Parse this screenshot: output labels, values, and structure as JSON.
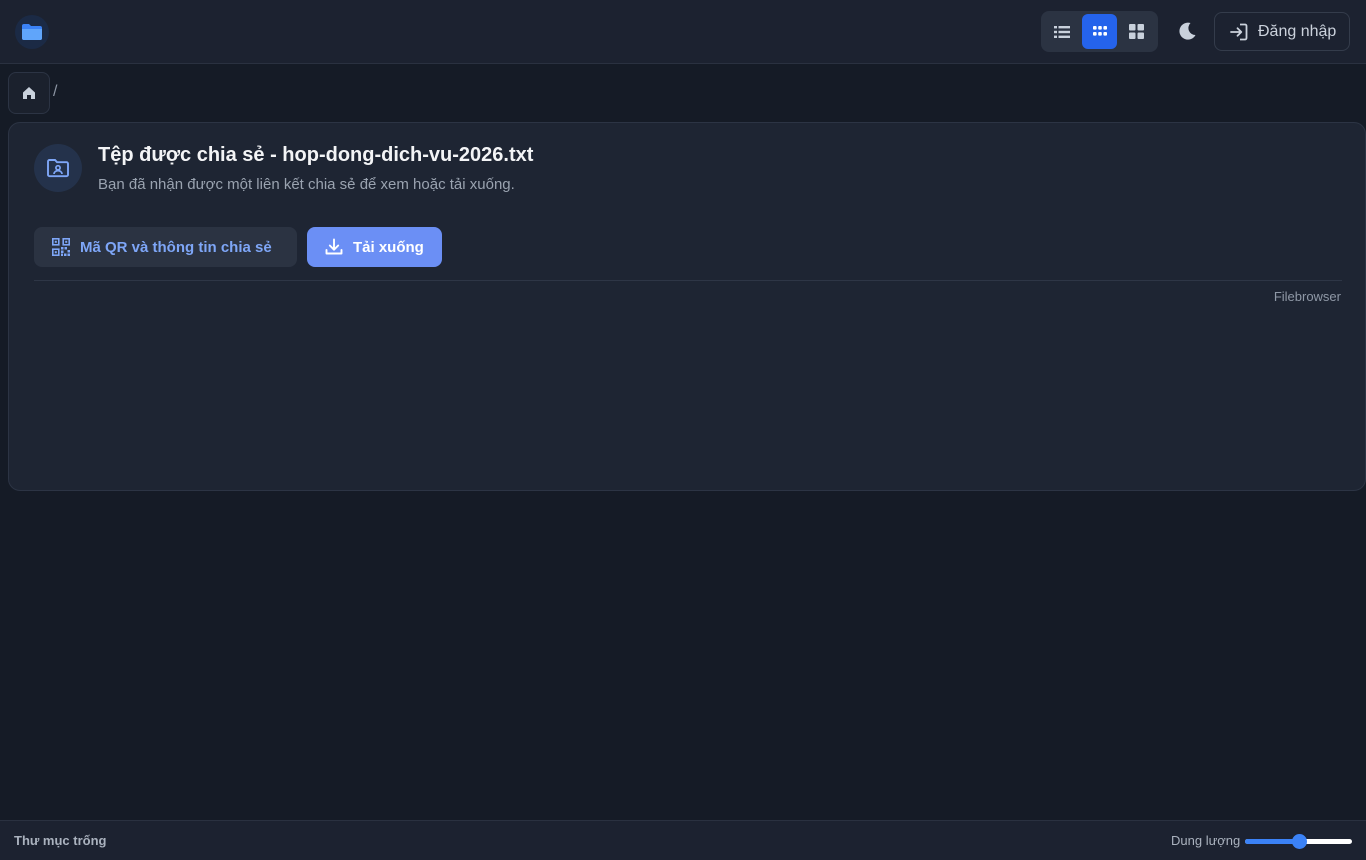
{
  "header": {
    "logo_icon": "folder-icon",
    "view_modes": [
      {
        "icon": "list-view-icon",
        "active": false
      },
      {
        "icon": "grid-view-icon",
        "active": true
      },
      {
        "icon": "tiles-view-icon",
        "active": false
      }
    ],
    "theme_icon": "moon-icon",
    "login_label": "Đăng nhập",
    "login_icon": "login-icon"
  },
  "breadcrumb": {
    "home_icon": "home-icon",
    "separator": "/"
  },
  "share": {
    "icon": "shared-folder-icon",
    "title": "Tệp được chia sẻ - hop-dong-dich-vu-2026.txt",
    "subtitle": "Bạn đã nhận được một liên kết chia sẻ để xem hoặc tải xuống.",
    "qr_button_label": "Mã QR và thông tin chia sẻ",
    "download_button_label": "Tải xuống",
    "credit": "Filebrowser"
  },
  "status": {
    "text": "Thư mục trống",
    "size_label": "Dung lượng",
    "size_slider_value": 0.5
  },
  "colors": {
    "accent": "#2563eb",
    "download_button": "#6b8ff5",
    "qr_text": "#7ea6f7"
  }
}
